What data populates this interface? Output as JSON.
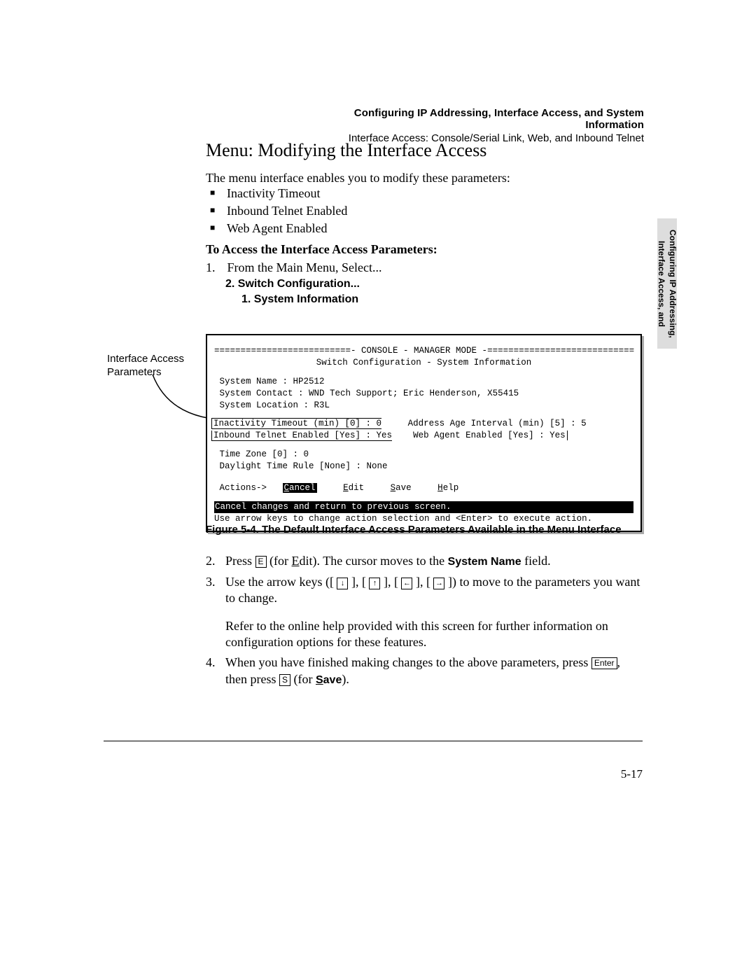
{
  "header": {
    "line1": "Configuring IP Addressing, Interface Access, and System Information",
    "line2": "Interface Access: Console/Serial Link, Web, and Inbound Telnet"
  },
  "side_tab": {
    "line1": "Configuring IP Addressing,",
    "line2": "Interface Access, and"
  },
  "title": "Menu: Modifying the Interface Access",
  "intro": "The menu interface enables you to modify these parameters:",
  "bullets": [
    "Inactivity Timeout",
    "Inbound Telnet Enabled",
    "Web Agent Enabled"
  ],
  "access_heading": "To Access the Interface Access Parameters:",
  "step1": {
    "num": "1.",
    "text": "From the Main Menu, Select..."
  },
  "sub1": "2. Switch Configuration...",
  "sub2": "1. System Information",
  "callout": "Interface Access Parameters",
  "console": {
    "header_dashes": "==========================- CONSOLE - MANAGER MODE -============================",
    "subtitle": "Switch Configuration - System Information",
    "sys_name": " System Name : HP2512",
    "sys_contact": " System Contact : WND Tech Support; Eric Henderson, X55415",
    "sys_loc": " System Location : R3L",
    "row_a_left": "Inactivity Timeout (min) [0] : 0",
    "row_a_right": "Address Age Interval (min) [5] : 5",
    "row_b_left": "Inbound Telnet Enabled [Yes] : Yes",
    "row_b_right": "Web Agent Enabled [Yes] : Yes",
    "tz": " Time Zone [0] : 0",
    "dst": " Daylight Time Rule [None] : None",
    "actions_prefix": " Actions->   ",
    "cancel_c": "C",
    "cancel_r": "ancel",
    "edit_e": "E",
    "edit_r": "dit",
    "save_s": "S",
    "save_r": "ave",
    "help_h": "H",
    "help_r": "elp",
    "status1": "Cancel changes and return to previous screen.                                  ",
    "status2": "Use arrow keys to change action selection and <Enter> to execute action."
  },
  "figure_caption": "Figure 5-4.  The Default Interface Access Parameters Available in the Menu Interface",
  "step2": {
    "num": "2.",
    "pre": "Press ",
    "key": "E",
    "mid_a": " (for ",
    "edit_u": "E",
    "edit_r": "dit",
    "mid_b": "). The cursor moves to the ",
    "bold": "System Name",
    "end": " field."
  },
  "step3": {
    "num": "3.",
    "pre": "Use the arrow keys ([ ",
    "sep": " ], [ ",
    "mid": " ]) to move to the parameters you want to change.",
    "para2": "Refer to the online help provided with this screen for further information on configuration options for these features."
  },
  "step4": {
    "num": "4.",
    "pre": "When you have finished making changes to the above parameters, press ",
    "enter": "Enter",
    "mid": ", then press ",
    "skey": "S",
    "mid2": " (for ",
    "save_u": "S",
    "save_r": "ave",
    "end": ")."
  },
  "page_num": "5-17"
}
